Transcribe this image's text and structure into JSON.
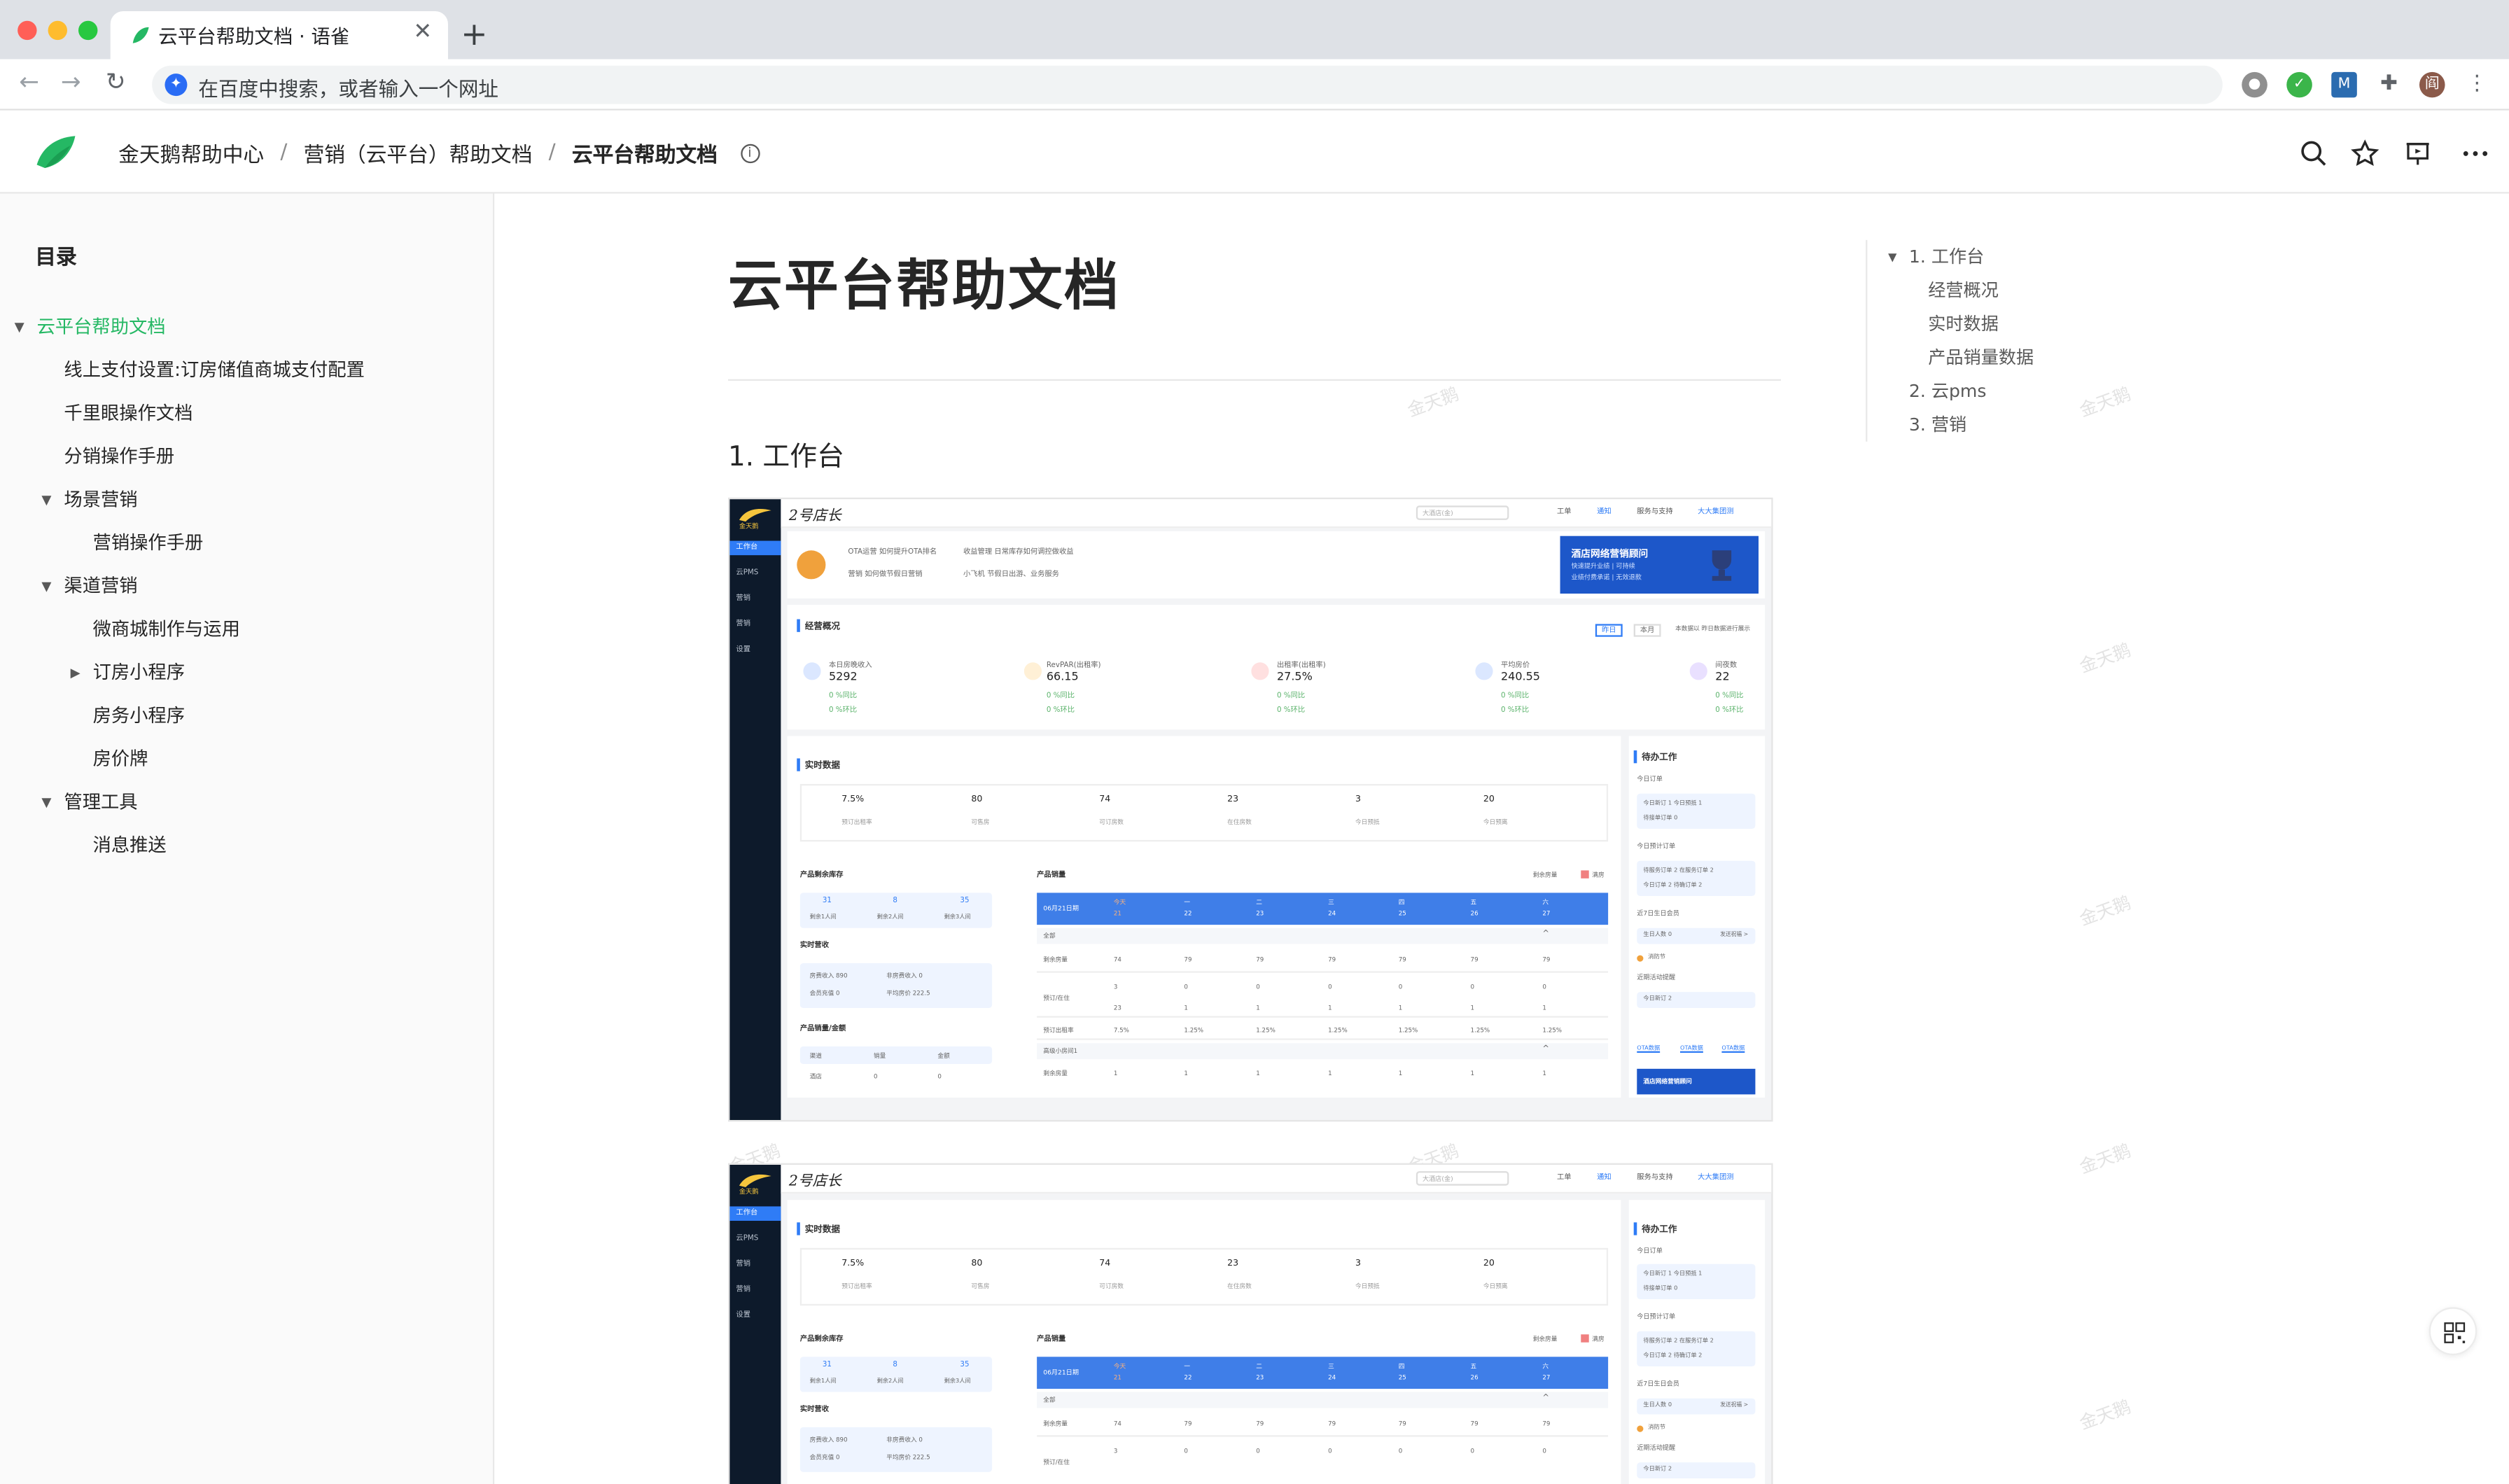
{
  "browser": {
    "tab_title": "云平台帮助文档 · 语雀",
    "new_tab": "+",
    "close": "✕",
    "address_placeholder": "在百度中搜索，或者输入一个网址",
    "profile": "阎"
  },
  "header": {
    "breadcrumbs": [
      "金天鹅帮助中心",
      "营销（云平台）帮助文档",
      "云平台帮助文档"
    ],
    "separator": "/"
  },
  "sidebar": {
    "title": "目录",
    "items": [
      {
        "label": "云平台帮助文档",
        "level": 0,
        "expanded": true,
        "active": true
      },
      {
        "label": "线上支付设置:订房储值商城支付配置",
        "level": 1
      },
      {
        "label": "千里眼操作文档",
        "level": 1
      },
      {
        "label": "分销操作手册",
        "level": 1
      },
      {
        "label": "场景营销",
        "level": 1,
        "expanded": true
      },
      {
        "label": "营销操作手册",
        "level": 2
      },
      {
        "label": "渠道营销",
        "level": 1,
        "expanded": true
      },
      {
        "label": "微商城制作与运用",
        "level": 2
      },
      {
        "label": "订房小程序",
        "level": 2,
        "collapsed": true
      },
      {
        "label": "房务小程序",
        "level": 2
      },
      {
        "label": "房价牌",
        "level": 2
      },
      {
        "label": "管理工具",
        "level": 1,
        "expanded": true
      },
      {
        "label": "消息推送",
        "level": 2
      }
    ]
  },
  "doc": {
    "title": "云平台帮助文档",
    "section1": "1. 工作台",
    "watermark": "金天鹅"
  },
  "toc": {
    "items": [
      {
        "label": "1. 工作台",
        "level": 0
      },
      {
        "label": "经营概况",
        "level": 1
      },
      {
        "label": "实时数据",
        "level": 1
      },
      {
        "label": "产品销量数据",
        "level": 1
      },
      {
        "label": "2. 云pms",
        "level": 0
      },
      {
        "label": "3. 营销",
        "level": 0
      }
    ]
  },
  "screenshot": {
    "store_name": "2号店长",
    "brand": "金天鹅",
    "search_placeholder": "大酒店(金)",
    "top_links": [
      "工单",
      "通知",
      "服务与支持",
      "大大集团测"
    ],
    "nav": [
      "工作台",
      "云PMS",
      "营销",
      "营销",
      "设置"
    ],
    "banner": {
      "title": "酒店网络营销顾问",
      "line1": "快速提升业绩 | 可持续",
      "line2": "业绩付费承诺 | 无效退款"
    },
    "notices": [
      "OTA运营 如何提升OTA排名",
      "收益管理 日常库存如何调控做收益",
      "营销 如何做节假日营销",
      "小飞机 节假日出游、业务服务"
    ],
    "overview": {
      "title": "经营概况",
      "toggle": [
        "昨日",
        "本月"
      ],
      "note": "本数据以 昨日数据进行展示",
      "kpis": [
        {
          "label": "本日房晚收入",
          "value": "5292"
        },
        {
          "label": "RevPAR(出租率)",
          "value": "66.15"
        },
        {
          "label": "出租率(出租率)",
          "value": "27.5%"
        },
        {
          "label": "平均房价",
          "value": "240.55"
        },
        {
          "label": "间夜数",
          "value": "22"
        }
      ],
      "delta_a": "0 %同比",
      "delta_b": "0 %环比"
    },
    "realtime": {
      "title": "实时数据",
      "stats": [
        {
          "value": "7.5%",
          "label": "预订出租率"
        },
        {
          "value": "80",
          "label": "可售房"
        },
        {
          "value": "74",
          "label": "可订房数"
        },
        {
          "value": "23",
          "label": "在住房数"
        },
        {
          "value": "3",
          "label": "今日预抵"
        },
        {
          "value": "20",
          "label": "今日预离"
        }
      ]
    },
    "stock": {
      "title": "产品剩余库存",
      "cells": [
        {
          "v": "31",
          "l": "剩余1人间"
        },
        {
          "v": "8",
          "l": "剩余2人间"
        },
        {
          "v": "35",
          "l": "剩余3人间"
        }
      ]
    },
    "revenue": {
      "title": "实时营收",
      "rows": [
        "房费收入 890",
        "非房费收入 0",
        "会员充值 0",
        "平均房价 222.5"
      ]
    },
    "sales_all": {
      "title": "产品销量/金额",
      "cols": [
        "渠道",
        "销量",
        "金额"
      ],
      "row": [
        "酒店",
        "0",
        "0"
      ]
    },
    "sales": {
      "title": "产品销量",
      "legend": [
        "剩余房量",
        "满房"
      ],
      "date_label": "06月21日期",
      "days": [
        {
          "w": "今天",
          "d": "21"
        },
        {
          "w": "一",
          "d": "22"
        },
        {
          "w": "二",
          "d": "23"
        },
        {
          "w": "三",
          "d": "24"
        },
        {
          "w": "四",
          "d": "25"
        },
        {
          "w": "五",
          "d": "26"
        },
        {
          "w": "六",
          "d": "27"
        }
      ],
      "group_all": "全部",
      "group_b": "高级小房间1",
      "remain_label": "剩余房量",
      "remain": [
        "74",
        "79",
        "79",
        "79",
        "79",
        "79",
        "79"
      ],
      "booked_label": "预订/在住",
      "booked_top": [
        "3",
        "0",
        "0",
        "0",
        "0",
        "0",
        "0"
      ],
      "booked_bot": [
        "23",
        "1",
        "1",
        "1",
        "1",
        "1",
        "1"
      ],
      "rate_label": "预订出租率",
      "rate": [
        "7.5%",
        "1.25%",
        "1.25%",
        "1.25%",
        "1.25%",
        "1.25%",
        "1.25%"
      ],
      "remain_b": [
        "1",
        "1",
        "1",
        "1",
        "1",
        "1",
        "1"
      ]
    },
    "todo": {
      "title": "待办工作",
      "today_orders": "今日订单",
      "order_lines": [
        "今日新订 1 今日预抵 1",
        "待接单订单 0"
      ],
      "today_checkin": "今日预计订单",
      "checkin_lines": [
        "待服务订单 2 在服务订单 2",
        "今日订单 2 待确订单 2"
      ],
      "member": "近7日生日会员",
      "member_line": "生日人数 0",
      "member_more": "发送祝福 >",
      "holiday": "消防节",
      "activity": "近期活动提醒",
      "activity_line": "今日新订 2",
      "links": [
        "OTA数据",
        "OTA数据",
        "OTA数据"
      ],
      "banner": "酒店网络营销顾问"
    }
  }
}
